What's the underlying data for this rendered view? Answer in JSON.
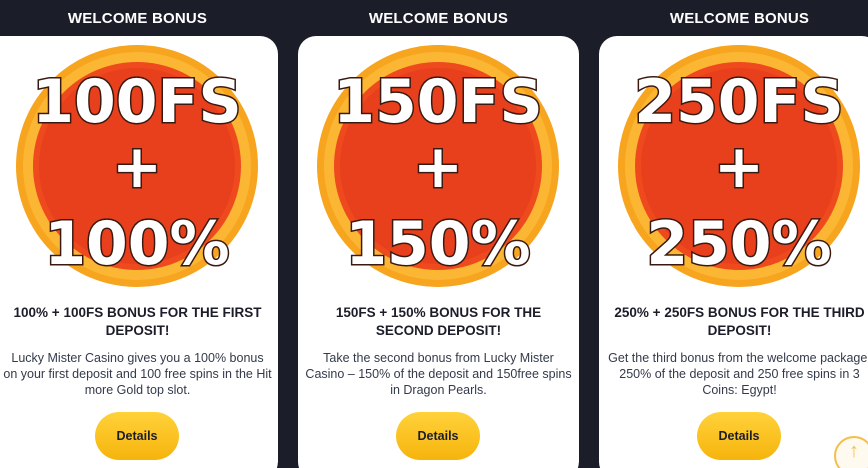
{
  "cards": [
    {
      "header": "WELCOME BONUS",
      "badge_lines": [
        "100FS",
        "+",
        "100%"
      ],
      "title": "100% + 100FS BONUS FOR THE FIRST DEPOSIT!",
      "description": "Lucky Mister Casino gives you a 100% bonus on your first deposit and 100 free spins in the Hit more Gold top slot.",
      "button": "Details"
    },
    {
      "header": "WELCOME BONUS",
      "badge_lines": [
        "150FS",
        "+",
        "150%"
      ],
      "title": "150FS + 150% BONUS FOR THE SECOND DEPOSIT!",
      "description": "Take the second bonus from Lucky Mister Casino – 150% of the deposit and 150free spins in Dragon Pearls.",
      "button": "Details"
    },
    {
      "header": "WELCOME BONUS",
      "badge_lines": [
        "250FS",
        "+",
        "250%"
      ],
      "title": "250% + 250FS BONUS FOR THE THIRD DEPOSIT!",
      "description": "Get the third bonus from the welcome package, 250% of the deposit and 250 free spins in 3 Coins: Egypt!",
      "button": "Details"
    }
  ],
  "colors": {
    "background": "#1b1d29",
    "card": "#ffffff",
    "medal_inner": "#e8401c",
    "medal_ring": "#f59a1c",
    "button": "#f8c01c"
  },
  "icons": {
    "scroll_top": "arrow-up-circle-icon"
  }
}
